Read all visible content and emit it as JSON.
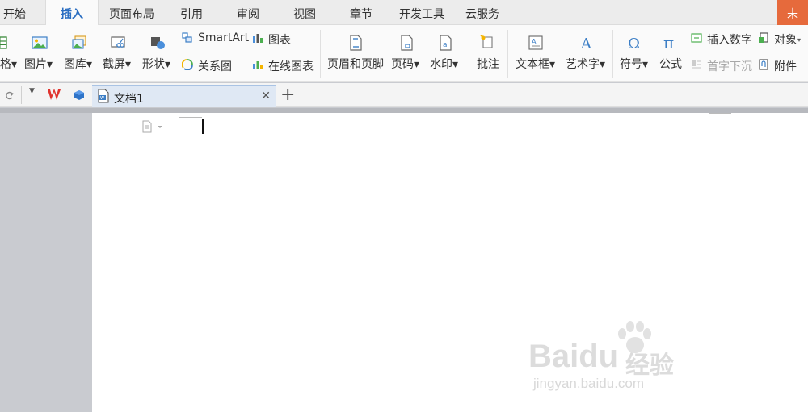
{
  "menu": {
    "tabs": [
      {
        "label": "开始"
      },
      {
        "label": "插入"
      },
      {
        "label": "页面布局"
      },
      {
        "label": "引用"
      },
      {
        "label": "审阅"
      },
      {
        "label": "视图"
      },
      {
        "label": "章节"
      },
      {
        "label": "开发工具"
      },
      {
        "label": "云服务"
      }
    ],
    "login_label": "未"
  },
  "ribbon": {
    "table_label": "格",
    "picture_label": "图片",
    "gallery_label": "图库",
    "screenshot_label": "截屏",
    "shape_label": "形状",
    "smartart_label": "SmartArt",
    "relation_label": "关系图",
    "chart_label": "图表",
    "online_chart_label": "在线图表",
    "header_footer_label": "页眉和页脚",
    "page_number_label": "页码",
    "watermark_label": "水印",
    "comment_label": "批注",
    "textbox_label": "文本框",
    "wordart_label": "艺术字",
    "symbol_label": "符号",
    "formula_label": "公式",
    "insert_number_label": "插入数字",
    "dropcap_label": "首字下沉",
    "object_label": "对象",
    "attachment_label": "附件"
  },
  "docbar": {
    "document_name": "文档1"
  },
  "watermark": {
    "brand": "Baidu",
    "brand_cn": "经验",
    "url": "jingyan.baidu.com"
  },
  "colors": {
    "accent": "#2b6ec1",
    "login": "#e66a3c",
    "wps_red": "#e0322d"
  }
}
